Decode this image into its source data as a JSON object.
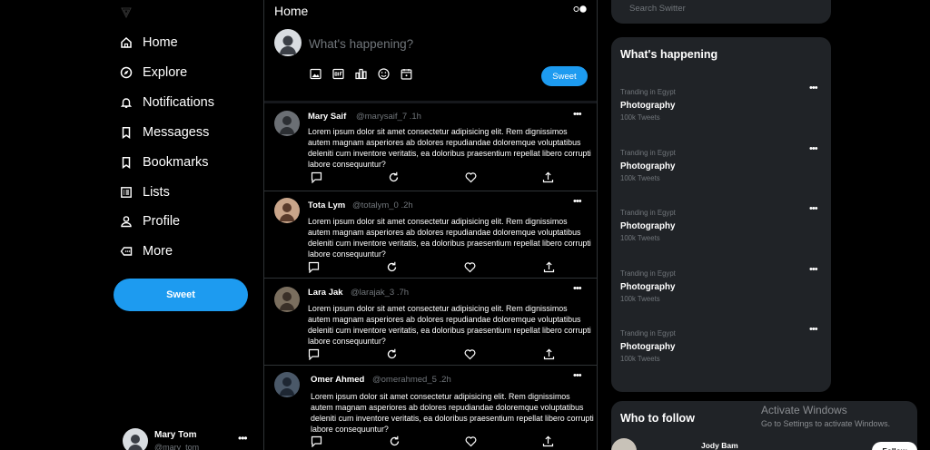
{
  "nav": {
    "items": [
      {
        "label": "Home",
        "icon": "home-icon"
      },
      {
        "label": "Explore",
        "icon": "compass-icon"
      },
      {
        "label": "Notifications",
        "icon": "bell-icon"
      },
      {
        "label": "Messagess",
        "icon": "bookmark-icon"
      },
      {
        "label": "Bookmarks",
        "icon": "bookmark-icon"
      },
      {
        "label": "Lists",
        "icon": "list-icon"
      },
      {
        "label": "Profile",
        "icon": "user-icon"
      },
      {
        "label": "More",
        "icon": "more-tag-icon"
      }
    ],
    "sweet_label": "Sweet"
  },
  "profile": {
    "name": "Mary Tom",
    "handle": "@mary_tom",
    "more": "•••"
  },
  "feed": {
    "title": "Home",
    "compose_placeholder": "What's happening?",
    "sweet_label": "Sweet",
    "tools": [
      "image-icon",
      "gif-icon",
      "poll-icon",
      "emoji-icon",
      "schedule-icon"
    ],
    "tweets": [
      {
        "name": "Mary Saif",
        "handle": "@marysaif_7 .1h",
        "more": "•••",
        "body": "Lorem ipsum dolor sit amet consectetur adipisicing elit. Rem dignissimos autem magnam asperiores ab dolores repudiandae doloremque voluptatibus deleniti cum inventore veritatis, ea doloribus praesentium repellat libero corrupti labore consequuntur?"
      },
      {
        "name": "Tota Lym",
        "handle": "@totalym_0 .2h",
        "more": "•••",
        "body": "Lorem ipsum dolor sit amet consectetur adipisicing elit. Rem dignissimos autem magnam asperiores ab dolores repudiandae doloremque voluptatibus deleniti cum inventore veritatis, ea doloribus praesentium repellat libero corrupti labore consequuntur?"
      },
      {
        "name": "Lara Jak",
        "handle": "@larajak_3 .7h",
        "more": "•••",
        "body": "Lorem ipsum dolor sit amet consectetur adipisicing elit. Rem dignissimos autem magnam asperiores ab dolores repudiandae doloremque voluptatibus deleniti cum inventore veritatis, ea doloribus praesentium repellat libero corrupti labore consequuntur?"
      },
      {
        "name": "Omer Ahmed",
        "handle": "@omerahmed_5 .2h",
        "more": "•••",
        "body": "Lorem ipsum dolor sit amet consectetur adipisicing elit. Rem dignissimos autem magnam asperiores ab dolores repudiandae doloremque voluptatibus deleniti cum inventore veritatis, ea doloribus praesentium repellat libero corrupti labore consequuntur?"
      }
    ]
  },
  "search": {
    "placeholder": "Search Switter"
  },
  "trends": {
    "title": "What's happening",
    "items": [
      {
        "category": "Tranding in Egypt",
        "name": "Photography",
        "count": "100k Tweets",
        "more": "•••"
      },
      {
        "category": "Tranding in Egypt",
        "name": "Photography",
        "count": "100k Tweets",
        "more": "•••"
      },
      {
        "category": "Tranding in Egypt",
        "name": "Photography",
        "count": "100k Tweets",
        "more": "•••"
      },
      {
        "category": "Tranding in Egypt",
        "name": "Photography",
        "count": "100k Tweets",
        "more": "•••"
      },
      {
        "category": "Tranding in Egypt",
        "name": "Photography",
        "count": "100k Tweets",
        "more": "•••"
      }
    ]
  },
  "who_to_follow": {
    "title": "Who to follow",
    "user_name": "Jody Bam",
    "follow_label": "Follow"
  },
  "windows_watermark": {
    "title": "Activate Windows",
    "subtitle": "Go to Settings to activate Windows."
  },
  "colors": {
    "accent": "#1d9bf0",
    "background": "#000000",
    "panel": "#202327",
    "muted": "#71767b"
  }
}
